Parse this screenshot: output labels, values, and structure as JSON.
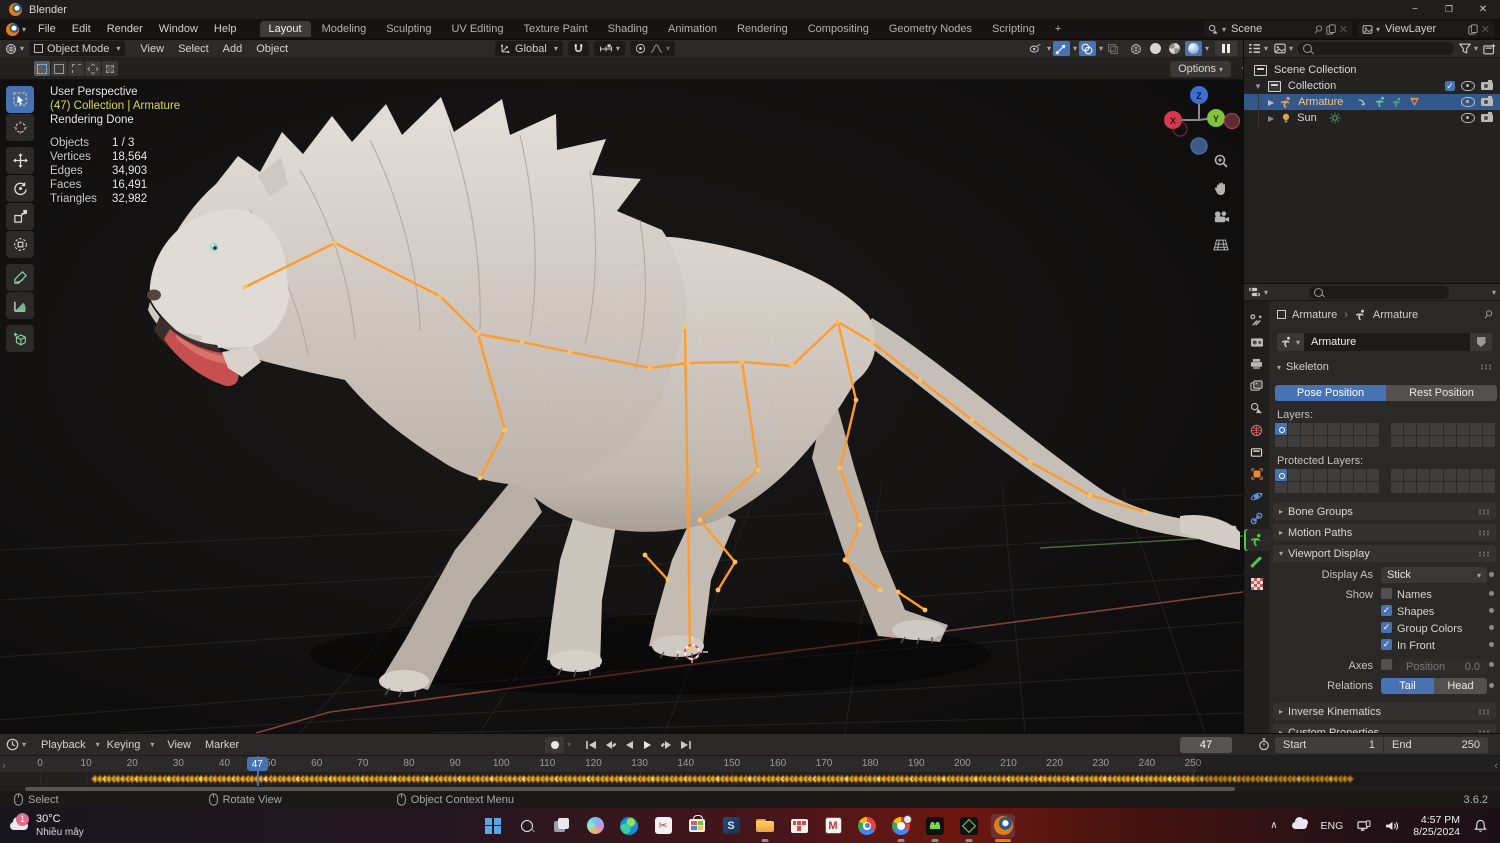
{
  "window": {
    "title": "Blender"
  },
  "menubar": {
    "items": [
      "File",
      "Edit",
      "Render",
      "Window",
      "Help"
    ]
  },
  "workspaces": {
    "tabs": [
      "Layout",
      "Modeling",
      "Sculpting",
      "UV Editing",
      "Texture Paint",
      "Shading",
      "Animation",
      "Rendering",
      "Compositing",
      "Geometry Nodes",
      "Scripting"
    ],
    "add_label": "+"
  },
  "selectors": {
    "scene": "Scene",
    "view_layer": "ViewLayer"
  },
  "viewport_header": {
    "mode": "Object Mode",
    "menus": [
      "View",
      "Select",
      "Add",
      "Object"
    ],
    "orientation": "Global",
    "options_label": "Options"
  },
  "viewport": {
    "overlay": {
      "perspective": "User Perspective",
      "context": "(47) Collection | Armature",
      "status": "Rendering Done"
    },
    "stats": [
      {
        "label": "Objects",
        "value": "1 / 3"
      },
      {
        "label": "Vertices",
        "value": "18,564"
      },
      {
        "label": "Edges",
        "value": "34,903"
      },
      {
        "label": "Faces",
        "value": "16,491"
      },
      {
        "label": "Triangles",
        "value": "32,982"
      }
    ],
    "gizmo": {
      "x": "X",
      "y": "Y",
      "z": "Z"
    }
  },
  "outliner": {
    "scene_collection": "Scene Collection",
    "collection": "Collection",
    "armature": "Armature",
    "sun": "Sun"
  },
  "properties": {
    "breadcrumb_object": "Armature",
    "breadcrumb_data": "Armature",
    "name_value": "Armature",
    "skeleton": {
      "title": "Skeleton",
      "pose_position": "Pose Position",
      "rest_position": "Rest Position",
      "layers_label": "Layers:",
      "protected_label": "Protected Layers:"
    },
    "panels": {
      "bone_groups": "Bone Groups",
      "motion_paths": "Motion Paths",
      "viewport_display": "Viewport Display",
      "inverse_kinematics": "Inverse Kinematics",
      "custom_properties": "Custom Properties"
    },
    "display": {
      "display_as_label": "Display As",
      "display_as_value": "Stick",
      "show_label": "Show",
      "names": "Names",
      "shapes": "Shapes",
      "group_colors": "Group Colors",
      "in_front": "In Front",
      "axes_label": "Axes",
      "position_placeholder": "Position",
      "position_value": "0.0",
      "relations_label": "Relations",
      "tail": "Tail",
      "head": "Head"
    }
  },
  "timeline": {
    "menus": [
      "Playback",
      "Keying",
      "View",
      "Marker"
    ],
    "current_frame": 47,
    "frame_display": "47",
    "start_label": "Start",
    "start_value": "1",
    "end_label": "End",
    "end_value": "250",
    "ticks": {
      "start": 0,
      "end": 250,
      "step": 10
    },
    "keyframes": {
      "first": 12,
      "last": 284,
      "step": 1
    }
  },
  "statusbar": {
    "hints": [
      "Select",
      "Rotate View",
      "Object Context Menu"
    ],
    "version": "3.6.2"
  },
  "taskbar": {
    "weather": {
      "badge": "1",
      "temp": "30°C",
      "condition": "Nhiều mây"
    },
    "tray": {
      "lang": "ENG",
      "time": "4:57 PM",
      "date": "8/25/2024"
    }
  },
  "colors": {
    "accent": "#4772b3",
    "armature": "#ff9c2c",
    "keyframe": "#e3a32d",
    "blender_orange": "#e87d0d"
  }
}
